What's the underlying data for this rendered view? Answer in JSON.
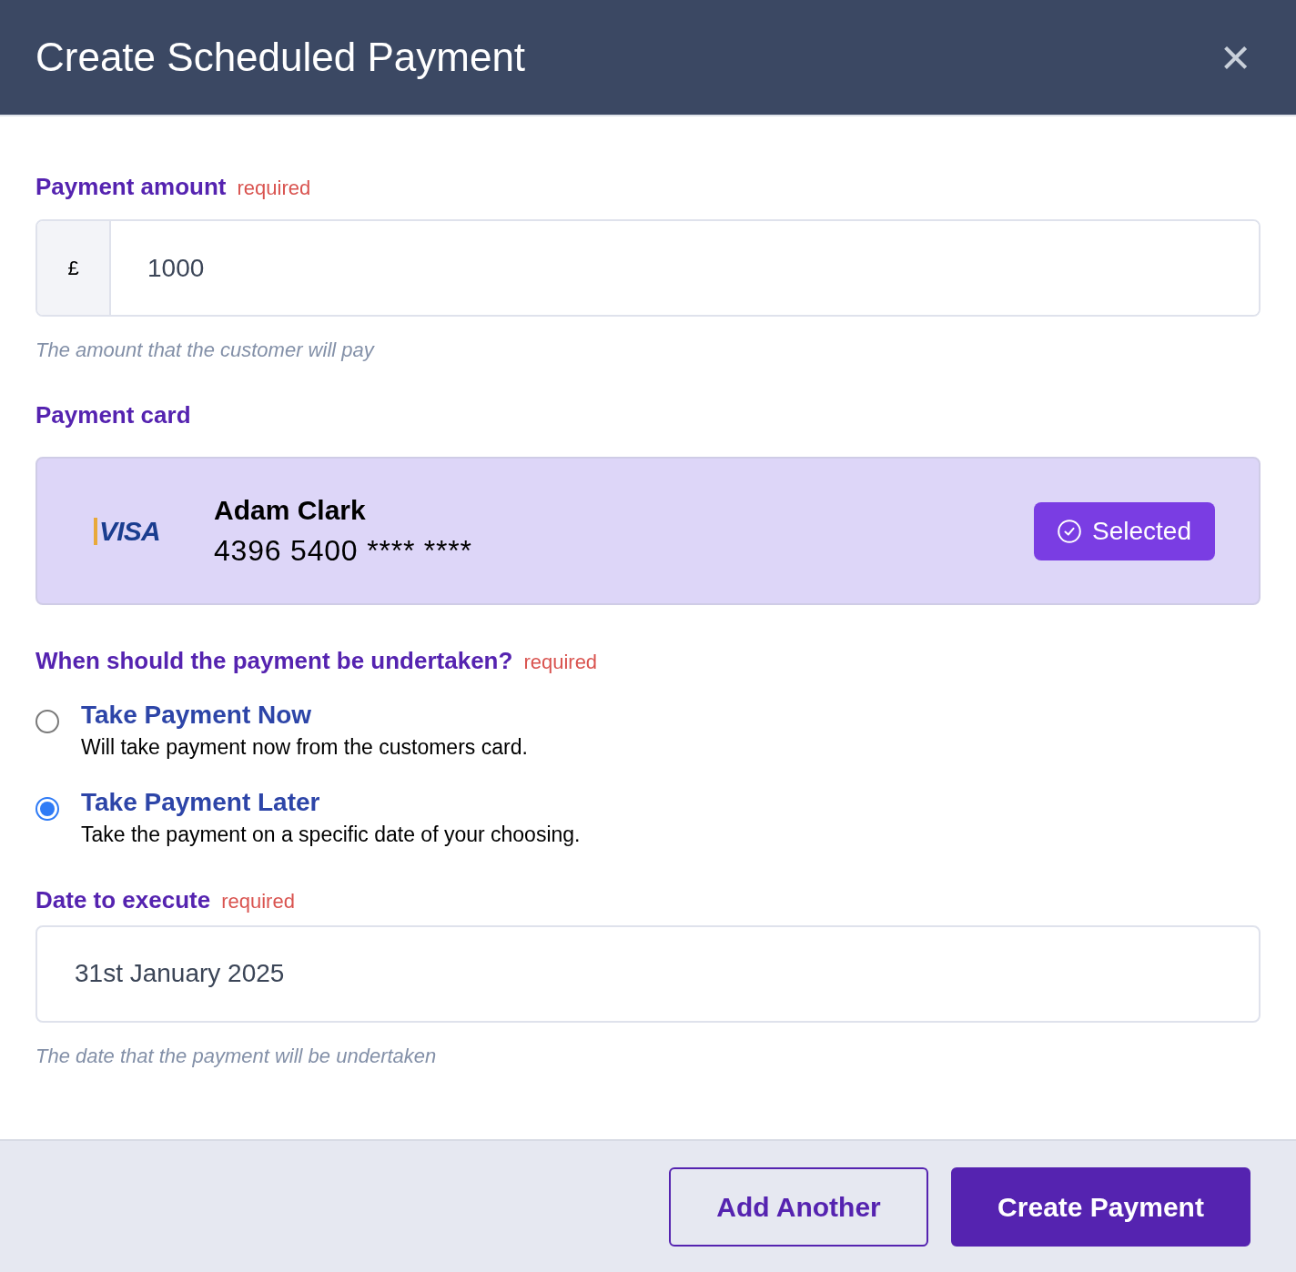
{
  "dialog": {
    "title": "Create Scheduled Payment",
    "close": "×"
  },
  "amount": {
    "label": "Payment amount",
    "required": "required",
    "prefix": "£",
    "value": "1000",
    "help": "The amount that the customer will pay"
  },
  "card": {
    "label": "Payment card",
    "brand": "VISA",
    "name": "Adam Clark",
    "number": "4396 5400 **** ****",
    "selected": true,
    "status": "Selected"
  },
  "timing": {
    "label": "When should the payment be undertaken?",
    "required": "required",
    "options": [
      {
        "title": "Take Payment Now",
        "description": "Will take payment now from the customers card.",
        "selected": false
      },
      {
        "title": "Take Payment Later",
        "description": "Take the payment on a specific date of your choosing.",
        "selected": true
      }
    ]
  },
  "date": {
    "label": "Date to execute",
    "required": "required",
    "value": "31st January 2025",
    "help": "The date that the payment will be undertaken"
  },
  "buttons": [
    {
      "label": "Add Another",
      "kind": "secondary"
    },
    {
      "label": "Create Payment",
      "kind": "primary"
    }
  ]
}
